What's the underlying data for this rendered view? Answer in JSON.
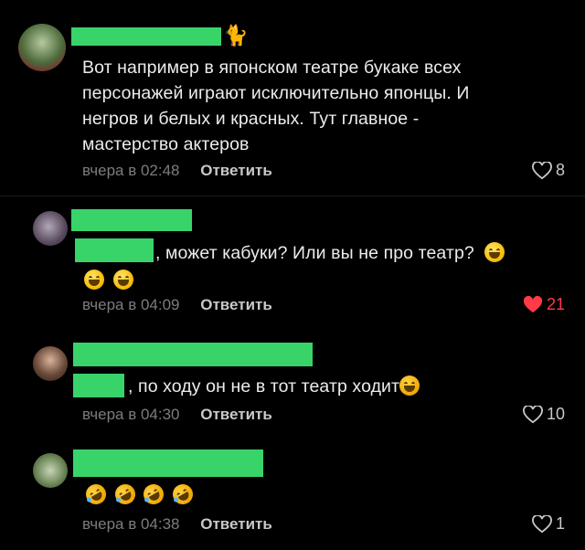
{
  "comments": [
    {
      "lines": [
        "Вот например в японском театре букаке всех",
        "персонажей играют исключительно японцы. И",
        "негров и белых и красных. Тут главное -",
        "мастерство актеров"
      ],
      "time": "вчера в 02:48",
      "reply": "Ответить",
      "likes": "8",
      "liked": false
    },
    {
      "text": ", может кабуки? Или вы не про театр?",
      "time": "вчера в 04:09",
      "reply": "Ответить",
      "likes": "21",
      "liked": true
    },
    {
      "text": ", по ходу он не в тот театр ходит",
      "time": "вчера в 04:30",
      "reply": "Ответить",
      "likes": "10",
      "liked": false
    },
    {
      "time": "вчера в 04:38",
      "reply": "Ответить",
      "likes": "1",
      "liked": false
    }
  ],
  "icons": {
    "heart_outline": "heart-outline-icon",
    "heart_filled": "heart-filled-icon",
    "emoji_grin": "grinning-emoji-icon",
    "emoji_laugh": "laughing-emoji-icon",
    "emoji_rofl": "rofl-emoji-icon",
    "cat": "cat-icon"
  },
  "colors": {
    "redact": "#38d46a",
    "like_active": "#ff3b47",
    "meta": "#7c7c80"
  }
}
